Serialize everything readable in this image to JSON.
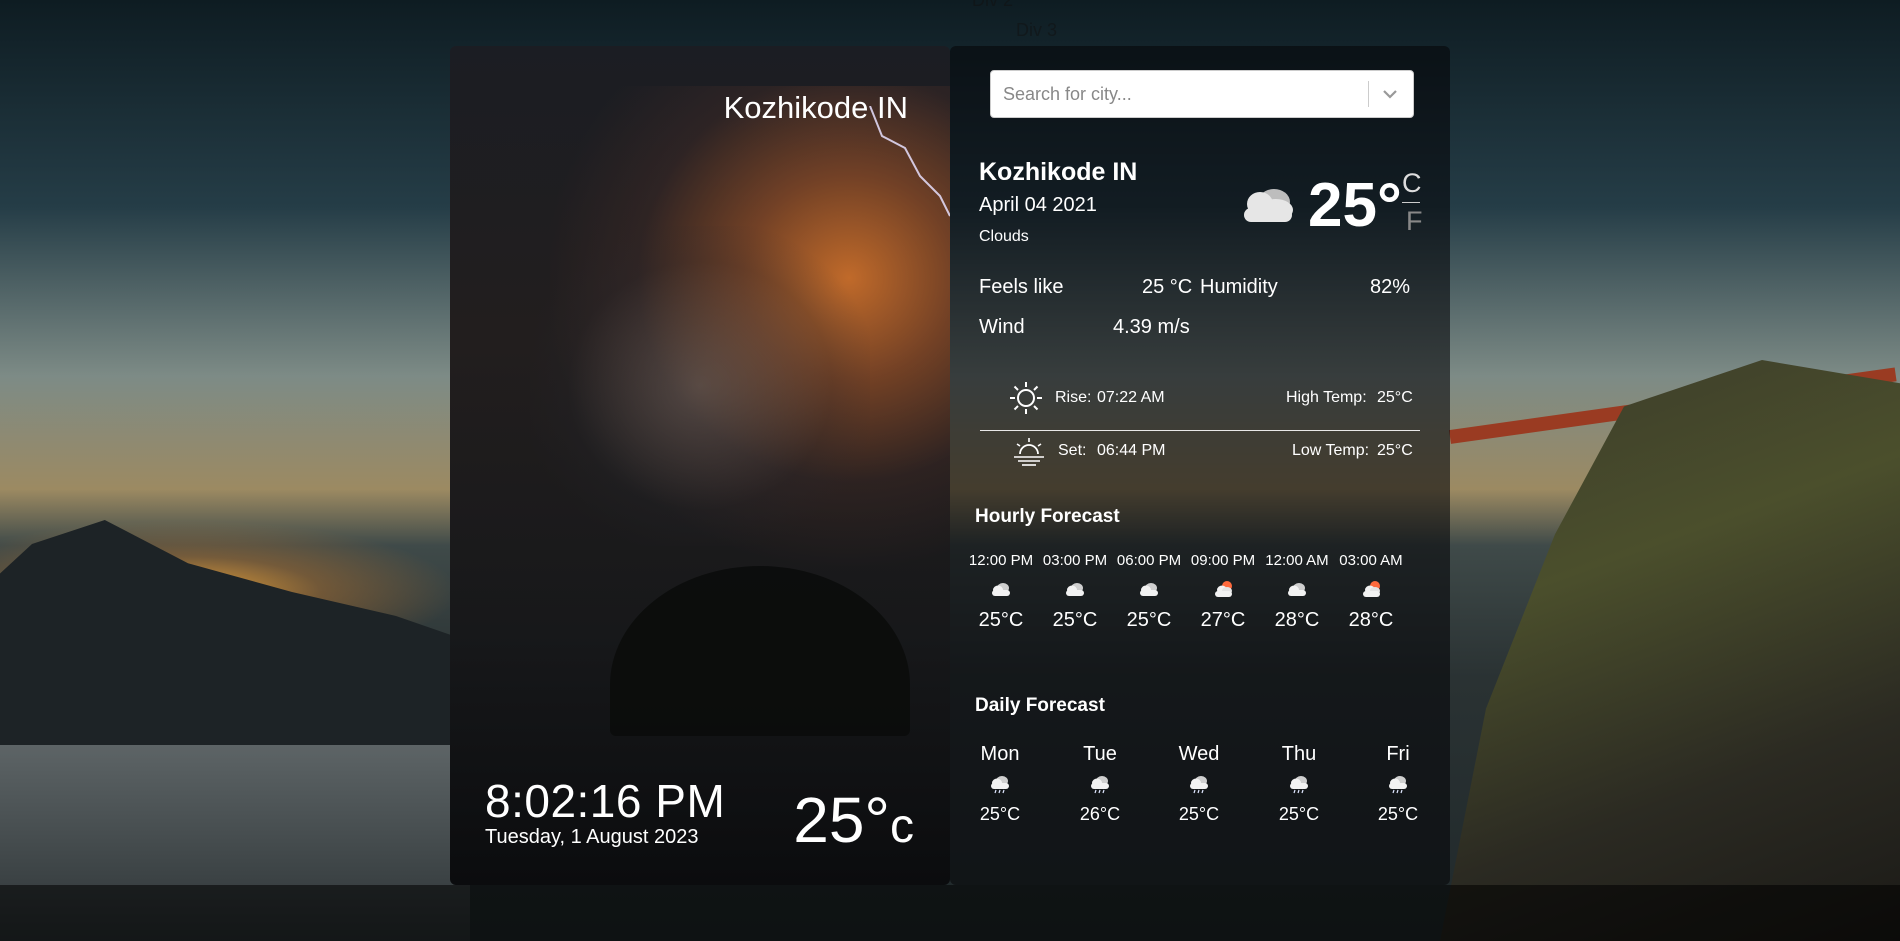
{
  "background_text": {
    "div2": "Div 2",
    "div3": "Div 3"
  },
  "left_panel": {
    "city": "Kozhikode IN",
    "time": "8:02:16 PM",
    "date": "Tuesday, 1 August 2023",
    "temp": "25°",
    "temp_unit": "c"
  },
  "search": {
    "placeholder": "Search for city..."
  },
  "current": {
    "city": "Kozhikode IN",
    "date": "April 04 2021",
    "condition": "Clouds",
    "temp": "25°",
    "unit_c": "C",
    "unit_f": "F",
    "icon": "cloud-icon"
  },
  "details": {
    "feels_like_label": "Feels like",
    "feels_like_value": "25 °C",
    "humidity_label": "Humidity",
    "humidity_value": "82%",
    "wind_label": "Wind",
    "wind_value": "4.39 m/s"
  },
  "sun": {
    "rise_label": "Rise:",
    "rise_time": "07:22 AM",
    "set_label": "Set:",
    "set_time": "06:44 PM",
    "high_label": "High Temp:",
    "high_value": "25°C",
    "low_label": "Low Temp:",
    "low_value": "25°C"
  },
  "hourly": {
    "title": "Hourly Forecast",
    "items": [
      {
        "time": "12:00 PM",
        "temp": "25°C",
        "icon": "cloud-icon"
      },
      {
        "time": "03:00 PM",
        "temp": "25°C",
        "icon": "cloud-icon"
      },
      {
        "time": "06:00 PM",
        "temp": "25°C",
        "icon": "cloud-icon"
      },
      {
        "time": "09:00 PM",
        "temp": "27°C",
        "icon": "sun-cloud-icon"
      },
      {
        "time": "12:00 AM",
        "temp": "28°C",
        "icon": "cloud-icon"
      },
      {
        "time": "03:00 AM",
        "temp": "28°C",
        "icon": "sun-cloud-icon"
      }
    ]
  },
  "daily": {
    "title": "Daily Forecast",
    "items": [
      {
        "day": "Mon",
        "temp": "25°C",
        "icon": "rain-cloud-icon"
      },
      {
        "day": "Tue",
        "temp": "26°C",
        "icon": "rain-cloud-icon"
      },
      {
        "day": "Wed",
        "temp": "25°C",
        "icon": "rain-cloud-icon"
      },
      {
        "day": "Thu",
        "temp": "25°C",
        "icon": "rain-cloud-icon"
      },
      {
        "day": "Fri",
        "temp": "25°C",
        "icon": "rain-cloud-icon"
      }
    ]
  },
  "colors": {
    "accent_sun": "#ff6a3d",
    "panel_bg": "#0a0b0d"
  }
}
